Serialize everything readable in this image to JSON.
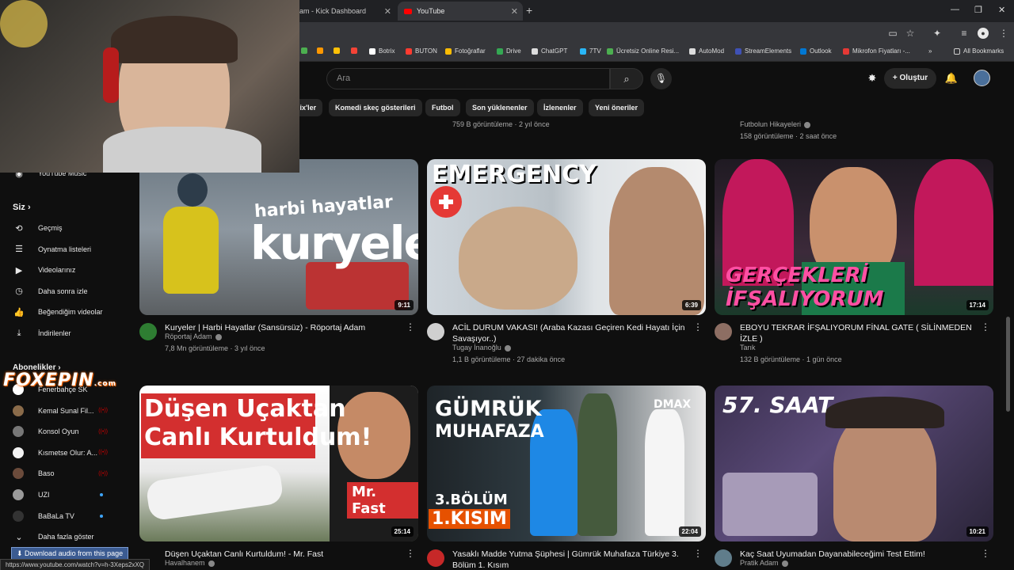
{
  "browser": {
    "tabs": [
      {
        "label": "am - Kick Dashboard"
      },
      {
        "label": "YouTube"
      }
    ],
    "bookmarks": [
      {
        "label": "Botrix",
        "color": "#ffffff"
      },
      {
        "label": "BUTON",
        "color": "#ff3b30"
      },
      {
        "label": "Fotoğraflar",
        "color": "#fbbc04"
      },
      {
        "label": "Drive",
        "color": "#34a853"
      },
      {
        "label": "ChatGPT",
        "color": "#dddddd"
      },
      {
        "label": "7TV",
        "color": "#29b6f6"
      },
      {
        "label": "Ücretsiz Online Resi...",
        "color": "#4caf50"
      },
      {
        "label": "AutoMod",
        "color": "#dddddd"
      },
      {
        "label": "StreamElements",
        "color": "#3f51b5"
      },
      {
        "label": "Outlook",
        "color": "#0078d4"
      },
      {
        "label": "Mikrofon Fiyatları -...",
        "color": "#e53935"
      }
    ],
    "all_bookmarks": "All Bookmarks",
    "more_bookmarks": "»"
  },
  "header": {
    "search_placeholder": "Ara",
    "create_label": "Oluştur"
  },
  "chips": [
    {
      "label": "lix'ler"
    },
    {
      "label": "Komedi skeç gösterileri"
    },
    {
      "label": "Futbol"
    },
    {
      "label": "Son yüklenenler"
    },
    {
      "label": "İzlenenler"
    },
    {
      "label": "Yeni öneriler"
    }
  ],
  "sidebar": {
    "youtube_music": "YouTube Music",
    "you_section": "Siz",
    "you_items": [
      {
        "label": "Geçmiş",
        "icon": "history-icon"
      },
      {
        "label": "Oynatma listeleri",
        "icon": "playlist-icon"
      },
      {
        "label": "Videolarınız",
        "icon": "your-videos-icon"
      },
      {
        "label": "Daha sonra izle",
        "icon": "watch-later-icon"
      },
      {
        "label": "Beğendiğim videolar",
        "icon": "like-icon"
      },
      {
        "label": "İndirilenler",
        "icon": "download-icon"
      }
    ],
    "subs_section": "Abonelikler",
    "subscriptions": [
      {
        "label": "Fenerbahçe SK",
        "color": "#ffffff",
        "badge": ""
      },
      {
        "label": "Kemal Sunal Fil...",
        "color": "#8a6b4a",
        "badge": "live"
      },
      {
        "label": "Konsol Oyun",
        "color": "#777777",
        "badge": "live"
      },
      {
        "label": "Kısmetse Olur: A...",
        "color": "#f2f2f2",
        "badge": "live"
      },
      {
        "label": "Baso",
        "color": "#6b4b3b",
        "badge": "live"
      },
      {
        "label": "UZI",
        "color": "#9a9a9a",
        "badge": "dot"
      },
      {
        "label": "BaBaLa TV",
        "color": "#333333",
        "badge": "dot"
      }
    ],
    "show_more": "Daha fazla göster"
  },
  "prev_row": {
    "meta_mid": "759 B görüntüleme · 2 yıl önce",
    "channel_right": "Futbolun Hikayeleri",
    "meta_right": "158 görüntüleme · 2 saat önce"
  },
  "videos": [
    {
      "title": "Kuryeler | Harbi Hayatlar (Sansürsüz) - Röportaj Adam",
      "channel": "Röportaj Adam",
      "meta": "7,8 Mn görüntüleme · 3 yıl önce",
      "duration": "9:11",
      "thumb_text_1": "harbi hayatlar",
      "thumb_text_2": "kuryeler"
    },
    {
      "title": "ACİL DURUM VAKASI! (Araba Kazası Geçiren Kedi Hayatı İçin Savaşıyor..)",
      "channel": "Tugay İnanoğlu",
      "meta": "1,1 B görüntüleme · 27 dakika önce",
      "duration": "6:39",
      "thumb_text_1": "EMERGENCY"
    },
    {
      "title": "EBOYU TEKRAR İFŞALIYORUM FİNAL GATE ( SİLİNMEDEN İZLE )",
      "channel": "Tarık",
      "meta": "132 B görüntüleme · 1 gün önce",
      "duration": "17:14",
      "thumb_text_1": "GERÇEKLERİ İFŞALIYORUM"
    },
    {
      "title": "Düşen Uçaktan Canlı Kurtuldum! - Mr. Fast",
      "channel": "Havalhanem",
      "meta": "",
      "duration": "25:14",
      "thumb_text_1": "Düşen Uçaktan",
      "thumb_text_2": "Canlı Kurtuldum!",
      "thumb_text_3": "Mr. Fast"
    },
    {
      "title": "Yasaklı Madde Yutma Şüphesi | Gümrük Muhafaza Türkiye 3. Bölüm 1. Kısım",
      "channel": "",
      "meta": "",
      "duration": "22:04",
      "thumb_text_1": "GÜMRÜK",
      "thumb_text_2": "MUHAFAZA",
      "thumb_text_3": "3.BÖLÜM",
      "thumb_text_4": "1.KISIM",
      "thumb_text_5": "DMAX"
    },
    {
      "title": "Kaç Saat Uyumadan Dayanabileceğimi Test Ettim!",
      "channel": "Pratik Adam",
      "meta": "",
      "duration": "10:21",
      "thumb_text_1": "57. SAAT"
    }
  ],
  "overlay": {
    "logo": "FOXEPIN",
    "logo_suffix": ".com",
    "download_bar": "Download audio from this page",
    "status_url": "https://www.youtube.com/watch?v=h-3Xeps2xXQ"
  }
}
